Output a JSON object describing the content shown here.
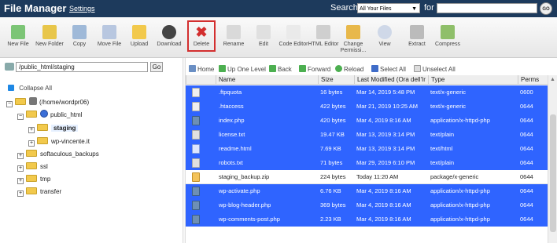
{
  "header": {
    "title": "File Manager",
    "settings": "Settings",
    "search_label": "Search",
    "search_scope": "All Your Files",
    "for_label": "for",
    "search_value": "",
    "go": "GO"
  },
  "toolbar": [
    {
      "label": "New File",
      "icon": "new-file-icon"
    },
    {
      "label": "New Folder",
      "icon": "new-folder-icon"
    },
    {
      "label": "Copy",
      "icon": "copy-icon"
    },
    {
      "label": "Move File",
      "icon": "move-icon"
    },
    {
      "label": "Upload",
      "icon": "upload-icon"
    },
    {
      "label": "Download",
      "icon": "download-icon"
    },
    {
      "label": "Delete",
      "icon": "delete-icon"
    },
    {
      "label": "Rename",
      "icon": "rename-icon"
    },
    {
      "label": "Edit",
      "icon": "edit-icon"
    },
    {
      "label": "Code Editor",
      "icon": "code-editor-icon"
    },
    {
      "label": "HTML Editor",
      "icon": "html-editor-icon"
    },
    {
      "label": "Change Permissi...",
      "icon": "permissions-icon"
    },
    {
      "label": "View",
      "icon": "view-icon"
    },
    {
      "label": "Extract",
      "icon": "extract-icon"
    },
    {
      "label": "Compress",
      "icon": "compress-icon"
    }
  ],
  "path": {
    "value": "/public_html/staging",
    "go": "Go"
  },
  "tree": {
    "collapse_all": "Collapse All",
    "items": [
      {
        "label": "(/home/wordpr06)"
      },
      {
        "label": "public_html"
      },
      {
        "label": "staging"
      },
      {
        "label": "wp-vincente.it"
      },
      {
        "label": "softaculous_backups"
      },
      {
        "label": "ssl"
      },
      {
        "label": "tmp"
      },
      {
        "label": "transfer"
      }
    ]
  },
  "actions": {
    "home": "Home",
    "up_one_level": "Up One Level",
    "back": "Back",
    "forward": "Forward",
    "reload": "Reload",
    "select_all": "Select All",
    "unselect_all": "Unselect All"
  },
  "table": {
    "columns": [
      "Name",
      "Size",
      "Last Modified (Ora dell'Ir",
      "Type",
      "Perms"
    ],
    "rows": [
      {
        "name": ".ftpquota",
        "size": "16 bytes",
        "modified": "Mar 14, 2019 5:48 PM",
        "type": "text/x-generic",
        "perms": "0600",
        "selected": true,
        "kind": "quota"
      },
      {
        "name": ".htaccess",
        "size": "422 bytes",
        "modified": "Mar 21, 2019 10:25 AM",
        "type": "text/x-generic",
        "perms": "0644",
        "selected": true,
        "kind": "quota"
      },
      {
        "name": "index.php",
        "size": "420 bytes",
        "modified": "Mar 4, 2019 8:16 AM",
        "type": "application/x-httpd-php",
        "perms": "0644",
        "selected": true,
        "kind": "php"
      },
      {
        "name": "license.txt",
        "size": "19.47 KB",
        "modified": "Mar 13, 2019 3:14 PM",
        "type": "text/plain",
        "perms": "0644",
        "selected": true,
        "kind": "txt"
      },
      {
        "name": "readme.html",
        "size": "7.69 KB",
        "modified": "Mar 13, 2019 3:14 PM",
        "type": "text/html",
        "perms": "0644",
        "selected": true,
        "kind": "html"
      },
      {
        "name": "robots.txt",
        "size": "71 bytes",
        "modified": "Mar 29, 2019 6:10 PM",
        "type": "text/plain",
        "perms": "0644",
        "selected": true,
        "kind": "txt"
      },
      {
        "name": "staging_backup.zip",
        "size": "224 bytes",
        "modified": "Today 11:20 AM",
        "type": "package/x-generic",
        "perms": "0644",
        "selected": false,
        "kind": "zip"
      },
      {
        "name": "wp-activate.php",
        "size": "6.76 KB",
        "modified": "Mar 4, 2019 8:16 AM",
        "type": "application/x-httpd-php",
        "perms": "0644",
        "selected": true,
        "kind": "php"
      },
      {
        "name": "wp-blog-header.php",
        "size": "369 bytes",
        "modified": "Mar 4, 2019 8:16 AM",
        "type": "application/x-httpd-php",
        "perms": "0644",
        "selected": true,
        "kind": "php"
      },
      {
        "name": "wp-comments-post.php",
        "size": "2.23 KB",
        "modified": "Mar 4, 2019 8:16 AM",
        "type": "application/x-httpd-php",
        "perms": "0644",
        "selected": true,
        "kind": "php"
      }
    ]
  }
}
